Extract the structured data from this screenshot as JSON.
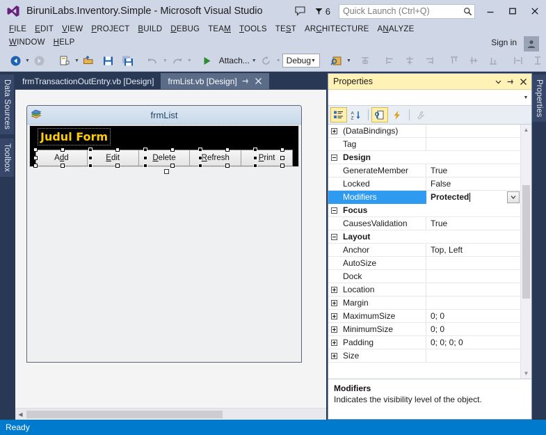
{
  "window": {
    "title": "BiruniLabs.Inventory.Simple - Microsoft Visual Studio",
    "logo_icon": "visual-studio-logo",
    "feedback_icon": "feedback-speech-bubble-icon",
    "notifications_icon": "notification-flag-icon",
    "notifications_count": "6",
    "minimize_label": "–",
    "maximize_label": "❑",
    "close_label": "✕"
  },
  "quick_launch": {
    "placeholder": "Quick Launch (Ctrl+Q)",
    "value": "",
    "search_icon": "search-magnifier-icon"
  },
  "menu": {
    "items": [
      {
        "label": "FILE",
        "accel": "F"
      },
      {
        "label": "EDIT",
        "accel": "E"
      },
      {
        "label": "VIEW",
        "accel": "V"
      },
      {
        "label": "PROJECT",
        "accel": "P"
      },
      {
        "label": "BUILD",
        "accel": "B"
      },
      {
        "label": "DEBUG",
        "accel": "D"
      },
      {
        "label": "TEAM",
        "accel": "M"
      },
      {
        "label": "TOOLS",
        "accel": "T"
      },
      {
        "label": "TEST",
        "accel": "S"
      },
      {
        "label": "ARCHITECTURE",
        "accel": "C"
      },
      {
        "label": "ANALYZE",
        "accel": "N"
      },
      {
        "label": "WINDOW",
        "accel": "W"
      },
      {
        "label": "HELP",
        "accel": "H"
      }
    ],
    "sign_in": "Sign in",
    "account_icon": "user-account-icon"
  },
  "toolbar": {
    "navigate_back_icon": "navigate-back-icon",
    "navigate_forward_icon": "navigate-forward-icon",
    "new_item_icon": "new-item-icon",
    "open_file_icon": "open-file-icon",
    "save_icon": "save-icon",
    "save_all_icon": "save-all-icon",
    "undo_icon": "undo-icon",
    "redo_icon": "redo-icon",
    "start_icon": "start-debug-play-icon",
    "attach_label": "Attach...",
    "refresh_icon": "refresh-icon",
    "config_value": "Debug",
    "find_icon": "find-in-files-icon",
    "align_lefts_icon": "align-lefts-icon",
    "align_centers_icon": "align-centers-icon",
    "align_rights_icon": "align-rights-icon",
    "align_tops_icon": "align-tops-icon",
    "align_middles_icon": "align-middles-icon",
    "align_bottoms_icon": "align-bottoms-icon",
    "make_same_width_icon": "make-same-width-icon",
    "make_same_height_icon": "make-same-height-icon",
    "make_same_size_icon": "make-same-size-icon",
    "overflow_icon": "toolbar-overflow-icon"
  },
  "left_dock": {
    "tabs": [
      "Data Sources",
      "Toolbox"
    ]
  },
  "right_dock": {
    "tabs": [
      "Properties"
    ]
  },
  "document_tabs": [
    {
      "label": "frmTransactionOutEntry.vb [Design]",
      "active": false
    },
    {
      "label": "frmList.vb [Design]",
      "active": true
    }
  ],
  "tab_controls": {
    "pin_icon": "pin-icon",
    "close_icon": "close-x-icon"
  },
  "designer": {
    "form_title": "frmList",
    "form_icon": "form-window-icon",
    "heading_label": "Judul Form",
    "buttons": [
      {
        "label": "Add",
        "accel": "d"
      },
      {
        "label": "Edit",
        "accel": "E"
      },
      {
        "label": "Delete",
        "accel": "D"
      },
      {
        "label": "Refresh",
        "accel": "R"
      },
      {
        "label": "Print",
        "accel": "P"
      }
    ],
    "heading_color": "#ffcc00",
    "panel_color": "#000000"
  },
  "properties": {
    "title": "Properties",
    "dropdown_icon": "chevron-down-icon",
    "pin_icon": "pin-icon",
    "close_icon": "close-x-icon",
    "object_selector_value": "",
    "object_selector_caret": "chevron-down-icon",
    "toolbar": [
      {
        "name": "categorized-view-icon",
        "active": true
      },
      {
        "name": "alphabetical-sort-icon",
        "active": false
      },
      {
        "name": "properties-page-icon",
        "active": true
      },
      {
        "name": "events-lightning-icon",
        "active": false
      },
      {
        "name": "property-pages-wrench-icon",
        "active": false,
        "disabled": true
      }
    ],
    "rows": [
      {
        "name": "(DataBindings)",
        "value": "",
        "expander": "plus",
        "kind": "prop"
      },
      {
        "name": "Tag",
        "value": "",
        "expander": "none",
        "kind": "prop"
      },
      {
        "name": "Design",
        "value": "",
        "expander": "minus",
        "kind": "category"
      },
      {
        "name": "GenerateMember",
        "value": "True",
        "expander": "none",
        "kind": "prop"
      },
      {
        "name": "Locked",
        "value": "False",
        "expander": "none",
        "kind": "prop"
      },
      {
        "name": "Modifiers",
        "value": "Protected",
        "expander": "none",
        "kind": "prop",
        "selected": true,
        "editing": true,
        "has_dropdown": true
      },
      {
        "name": "Focus",
        "value": "",
        "expander": "minus",
        "kind": "category"
      },
      {
        "name": "CausesValidation",
        "value": "True",
        "expander": "none",
        "kind": "prop"
      },
      {
        "name": "Layout",
        "value": "",
        "expander": "minus",
        "kind": "category"
      },
      {
        "name": "Anchor",
        "value": "Top, Left",
        "expander": "none",
        "kind": "prop"
      },
      {
        "name": "AutoSize",
        "value": "",
        "expander": "none",
        "kind": "prop"
      },
      {
        "name": "Dock",
        "value": "",
        "expander": "none",
        "kind": "prop"
      },
      {
        "name": "Location",
        "value": "",
        "expander": "plus",
        "kind": "prop"
      },
      {
        "name": "Margin",
        "value": "",
        "expander": "plus",
        "kind": "prop"
      },
      {
        "name": "MaximumSize",
        "value": "0; 0",
        "expander": "plus",
        "kind": "prop"
      },
      {
        "name": "MinimumSize",
        "value": "0; 0",
        "expander": "plus",
        "kind": "prop"
      },
      {
        "name": "Padding",
        "value": "0; 0; 0; 0",
        "expander": "plus",
        "kind": "prop"
      },
      {
        "name": "Size",
        "value": "",
        "expander": "plus",
        "kind": "prop"
      }
    ],
    "description": {
      "title": "Modifiers",
      "text": "Indicates the visibility level of the object."
    },
    "selection_color": "#2f9bf0",
    "title_color": "#fff2b6"
  },
  "status_bar": {
    "text": "Ready",
    "color": "#007acc"
  }
}
